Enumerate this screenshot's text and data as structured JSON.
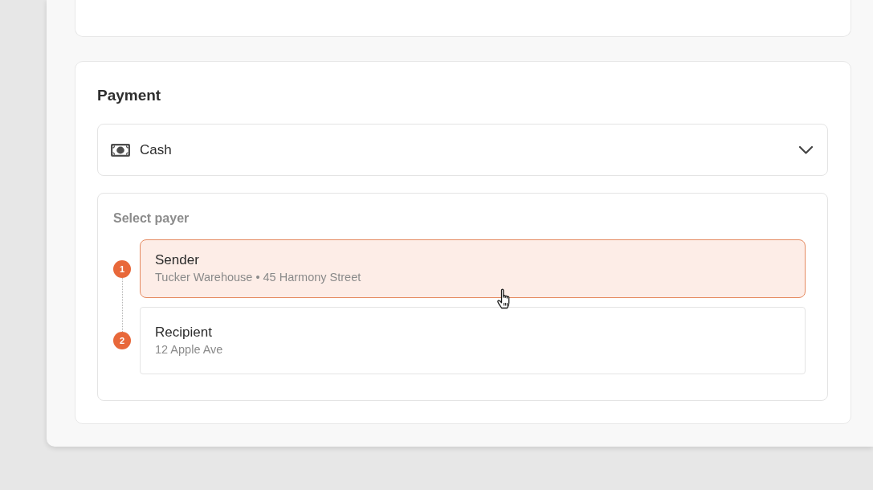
{
  "payment": {
    "title": "Payment",
    "method": {
      "label": "Cash",
      "expanded": false
    },
    "payer": {
      "label": "Select payer",
      "options": [
        {
          "step": "1",
          "name": "Sender",
          "address": "Tucker Warehouse • 45 Harmony Street",
          "selected": true
        },
        {
          "step": "2",
          "name": "Recipient",
          "address": "12 Apple Ave",
          "selected": false
        }
      ]
    }
  }
}
